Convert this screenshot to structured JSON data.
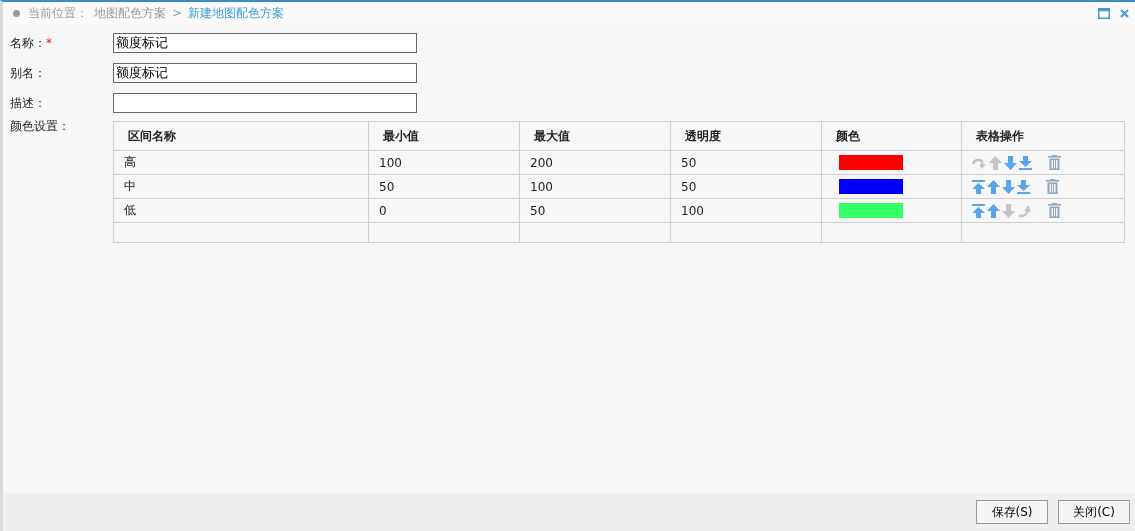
{
  "breadcrumb": {
    "label": "当前位置：",
    "items": [
      {
        "text": "地图配色方案",
        "selected": false
      },
      {
        "text": "新建地图配色方案",
        "selected": true
      }
    ],
    "separator": ">"
  },
  "fields": [
    {
      "label": "名称：",
      "required": true,
      "value": "额度标记"
    },
    {
      "label": "别名：",
      "required": false,
      "value": "额度标记"
    },
    {
      "label": "描述：",
      "required": false
    }
  ],
  "required_mark": "*",
  "color_settings": {
    "label": "颜色设置：",
    "columns": [
      "区间名称",
      "最小值",
      "最大值",
      "透明度",
      "颜色",
      "表格操作"
    ],
    "rows": [
      {
        "name": "高",
        "min": "100",
        "max": "200",
        "opacity": "50",
        "color": "#ff0000",
        "ops": [
          {
            "kind": "top",
            "disabled": true
          },
          {
            "kind": "up",
            "disabled": true
          },
          {
            "kind": "down",
            "disabled": false
          },
          {
            "kind": "bottom",
            "disabled": false
          }
        ]
      },
      {
        "name": "中",
        "min": "50",
        "max": "100",
        "opacity": "50",
        "color": "#0000ff",
        "ops": [
          {
            "kind": "top",
            "disabled": false
          },
          {
            "kind": "up",
            "disabled": false
          },
          {
            "kind": "down",
            "disabled": false
          },
          {
            "kind": "bottom",
            "disabled": false
          }
        ]
      },
      {
        "name": "低",
        "min": "0",
        "max": "50",
        "opacity": "100",
        "color": "#33ff66",
        "ops": [
          {
            "kind": "top",
            "disabled": false
          },
          {
            "kind": "up",
            "disabled": false
          },
          {
            "kind": "down",
            "disabled": true
          },
          {
            "kind": "bottom",
            "disabled": true
          }
        ]
      }
    ]
  },
  "buttons": [
    "保存(S)",
    "关闭(C)"
  ]
}
